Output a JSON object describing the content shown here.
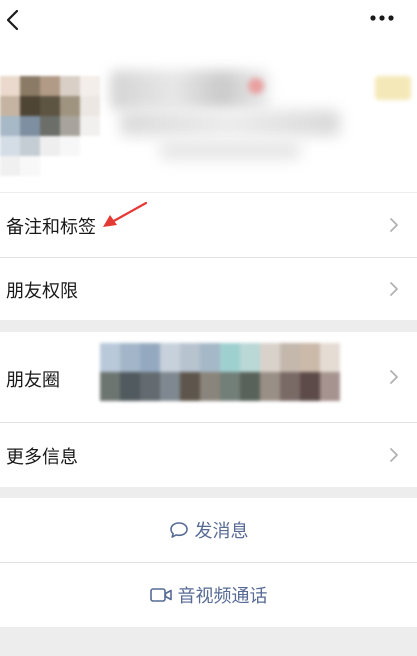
{
  "menu": {
    "remark_tags": "备注和标签",
    "friend_permissions": "朋友权限",
    "moments": "朋友圈",
    "more_info": "更多信息"
  },
  "actions": {
    "send_message": "发消息",
    "video_call": "音视频通话"
  },
  "colors": {
    "background": "#ededed",
    "card": "#ffffff",
    "text": "#191919",
    "link": "#576b95",
    "chevron": "#b2b2b2",
    "annotation_arrow": "#e53935"
  },
  "icons": {
    "top_left": "back-icon",
    "top_right": "more-icon",
    "row_end": "chevron-right-icon",
    "send_message": "chat-bubble-icon",
    "video_call": "video-camera-icon"
  }
}
